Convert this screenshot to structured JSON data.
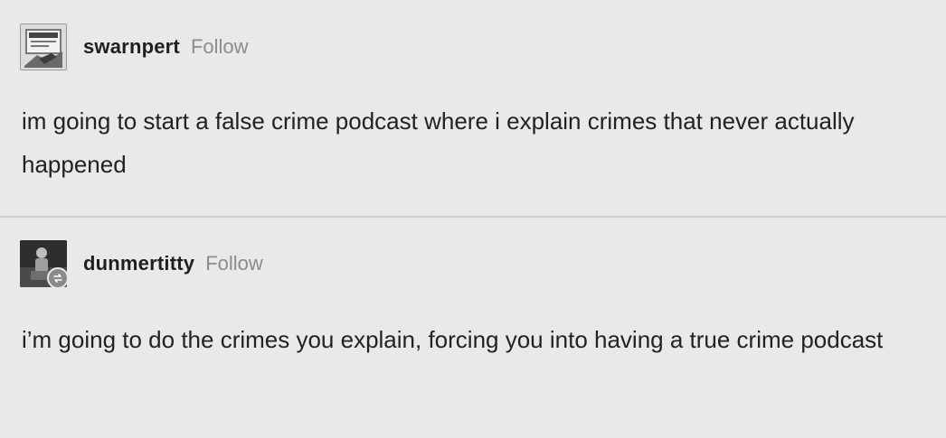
{
  "posts": [
    {
      "username": "swarnpert",
      "follow_label": "Follow",
      "avatar_icon": "sign-avatar-icon",
      "text": "im going to start a false crime podcast where i explain crimes that never actually happened"
    },
    {
      "username": "dunmertitty",
      "follow_label": "Follow",
      "avatar_icon": "figure-avatar-icon",
      "reblog_icon": "reblog-icon",
      "text": "i’m going to do the crimes you explain, forcing you into having a true crime podcast"
    }
  ],
  "colors": {
    "background": "#e9e9e9",
    "text": "#222222",
    "follow": "#8c8c8c",
    "divider": "#cfcfcf"
  }
}
